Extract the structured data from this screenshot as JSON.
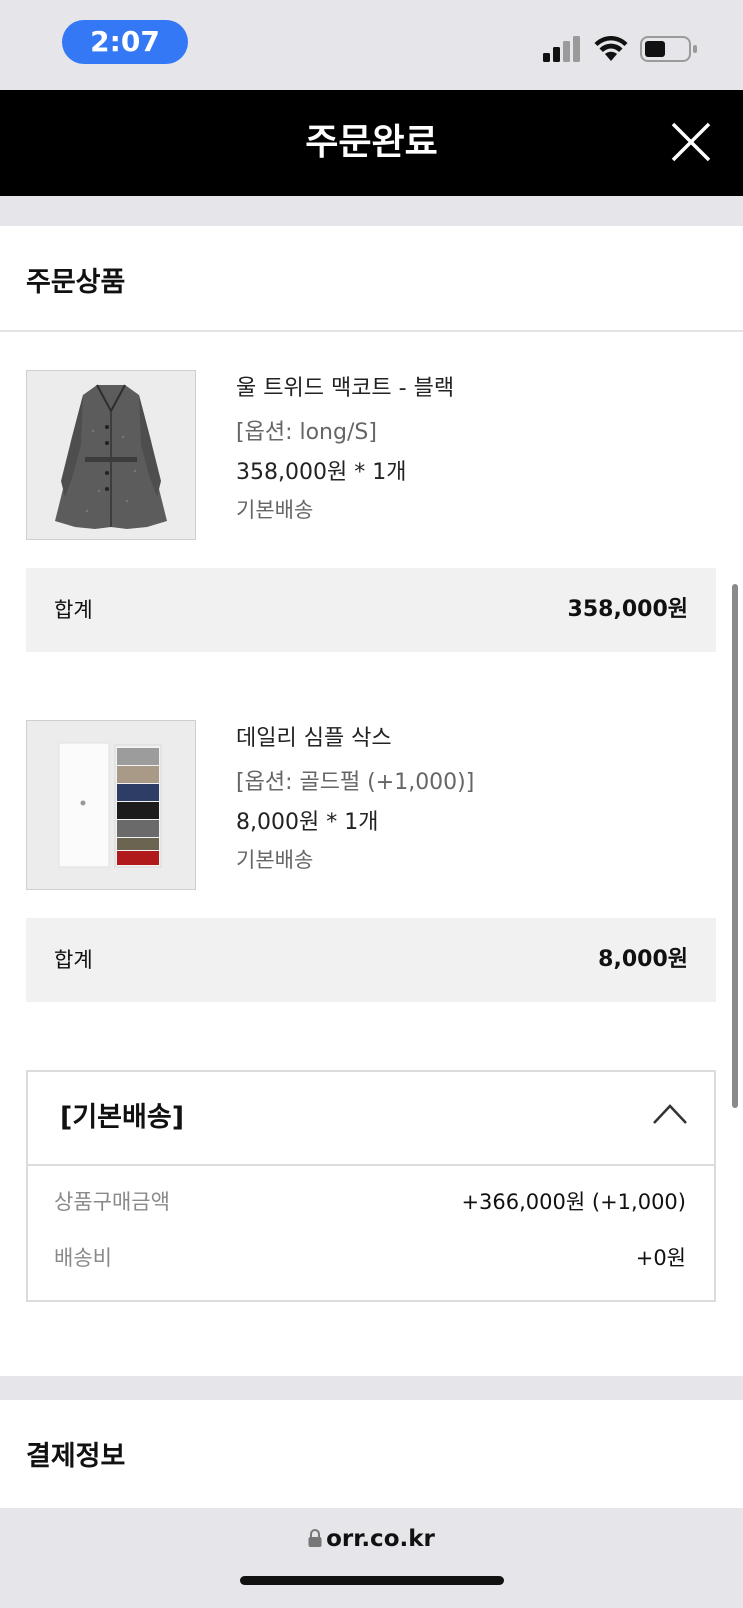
{
  "status_bar": {
    "time": "2:07"
  },
  "header": {
    "title": "주문완료"
  },
  "order_products": {
    "section_title": "주문상품",
    "items": [
      {
        "name": "울 트위드 맥코트 - 블랙",
        "option": "[옵션: long/S]",
        "price_qty": "358,000원 *  1개",
        "shipping": "기본배송",
        "subtotal_label": "합계",
        "subtotal_value": "358,000원",
        "thumbnail_icon": "coat-photo"
      },
      {
        "name": "데일리 심플 삭스",
        "option": "[옵션: 골드펄 (+1,000)]",
        "price_qty": "8,000원 *  1개",
        "shipping": "기본배송",
        "subtotal_label": "합계",
        "subtotal_value": "8,000원",
        "thumbnail_icon": "socks-box-photo"
      }
    ]
  },
  "shipping_summary": {
    "title": "[기본배송]",
    "rows": [
      {
        "label": "상품구매금액",
        "value": "+366,000원 (+1,000)"
      },
      {
        "label": "배송비",
        "value": "+0원"
      }
    ]
  },
  "payment_info": {
    "section_title": "결제정보"
  },
  "browser": {
    "url": "orr.co.kr"
  },
  "colors": {
    "status_pill": "#3478f6",
    "header_bg": "#000000",
    "subtotal_bg": "#f1f1f1",
    "page_bg": "#e5e5ea"
  }
}
